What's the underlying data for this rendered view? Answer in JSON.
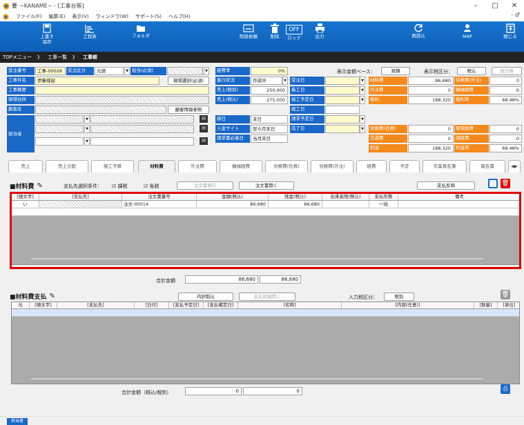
{
  "window": {
    "title": "~KANAME~ - [工事台帳]",
    "minimize": "–",
    "maximize": "□",
    "close": "✕"
  },
  "menu": {
    "items": [
      "ファイル(F)",
      "編集(E)",
      "表示(V)",
      "ウィンドウ(W)",
      "サポート(S)",
      "ヘルプ(H)"
    ],
    "right": "- ♂"
  },
  "toolbar": {
    "overwrite_save": "上書き 保存",
    "schedule": "工程表",
    "folder": "フォルダ",
    "delete_request": "削除依頼",
    "delete": "削除",
    "lock_state": "OFF",
    "lock": "ロック",
    "print": "出力",
    "reload": "再読込",
    "map": "MAP",
    "close": "閉じる"
  },
  "breadcrumb": [
    "TOPメニュー",
    "工事一覧",
    "工事帳"
  ],
  "header": {
    "order_no_label": "受注番号",
    "order_no": "工事-00028",
    "order_type_label": "受注区分",
    "order_type": "元請",
    "manager_label": "担当(必須)",
    "site_select_button": "現場選択(必須)",
    "name_label": "工事件名",
    "name": "伊藤様邸",
    "summary_label": "工事概要",
    "address_label": "現場住所",
    "customer_label": "顧客名",
    "customer_ref_button": "顧客情報参照",
    "staff_label": "担当者",
    "cost_rate_label": "経費率",
    "cost_rate": "0%",
    "progress_label": "進行状況",
    "progress": "作成中",
    "sales_excl_label": "売上(税別)",
    "sales_excl": "250,000",
    "sales_incl_label": "売上(税込)",
    "sales_incl": "275,000",
    "close_day_label": "締日",
    "close_day": "末日",
    "deposit_cycle_label": "入金サイト",
    "deposit_cycle": "翌々月末日",
    "invoice_required_label": "請求書必着日",
    "invoice_required": "当月末日",
    "order_date_label": "受注日",
    "start_date_label": "着工日",
    "complete_plan_label": "竣工予定日",
    "complete_date_label": "竣工日",
    "invoice_plan_label": "請求予定日",
    "finish_date_label": "完了日",
    "display_base_label": "表示金額ベース：",
    "display_base_button": "見積",
    "tax_display_label": "表示税区分：",
    "tax_display_button": "税込",
    "recalc_button": "再計算"
  },
  "costs": {
    "material_label": "材料費",
    "material": "86,680",
    "labor_outside_label": "労務費(外注)",
    "labor_outside": "0",
    "outsource_label": "外注費",
    "outsource": "0",
    "machine_label": "機械経費",
    "machine": "0",
    "gross_label": "粗利",
    "gross": "188,320",
    "gross_rate_label": "粗利率",
    "gross_rate": "68.48%",
    "labor_company_label": "労務費(社員)",
    "labor_company": "0",
    "site_cost_label": "現場経費",
    "site_cost": "0",
    "transport_label": "交通費",
    "transport": "0",
    "misc_label": "諸経費",
    "misc": "0",
    "profit_label": "利益",
    "profit": "188,320",
    "profit_rate_label": "利益率",
    "profit_rate": "68.48%"
  },
  "tabs": [
    "売上",
    "売上分配",
    "施工予算",
    "材料費",
    "外注費",
    "機械経費",
    "労務費(社員)",
    "労務費(外注)",
    "経費",
    "予定",
    "作業員名簿",
    "報告書"
  ],
  "material": {
    "title": "■材料費",
    "pay_cond_label": "支払先選択条件：",
    "taxable": "課税",
    "exempt": "免税",
    "order_issue_button": "注文書発行",
    "order_open_button": "注文書開く",
    "pay_reflect_button": "支払反映",
    "columns": [
      "[頭文字]",
      "[支払先]",
      "注文書番号",
      "金額(税込)",
      "残金(税込)",
      "出来高残(税込)",
      "支払形態",
      "備考"
    ],
    "rows": [
      {
        "initial": "い",
        "order_no": "注文-00014",
        "amount": "86,680",
        "remaining": "86,680",
        "progress_remaining": "",
        "pay_type": "一括",
        "note": ""
      }
    ],
    "total_label": "合計金額",
    "total_amount": "86,680",
    "total_remaining": "86,680"
  },
  "payment": {
    "title": "■材料費支払",
    "import_button": "内訳取込",
    "detail_open_button": "支払明細開く",
    "tax_input_label": "入力税区分：",
    "tax_input": "税別",
    "columns": [
      "元",
      "[頭文字]",
      "[支払先]",
      "[日付]",
      "[支払予定日]",
      "[支払確定日]",
      "[名称]",
      "[内容(任意)]",
      "[数量]",
      "[単位]"
    ],
    "total_label": "合計金額（税込/税別）",
    "total_incl": "0",
    "total_excl": "0"
  },
  "status": {
    "label": "担当者"
  }
}
